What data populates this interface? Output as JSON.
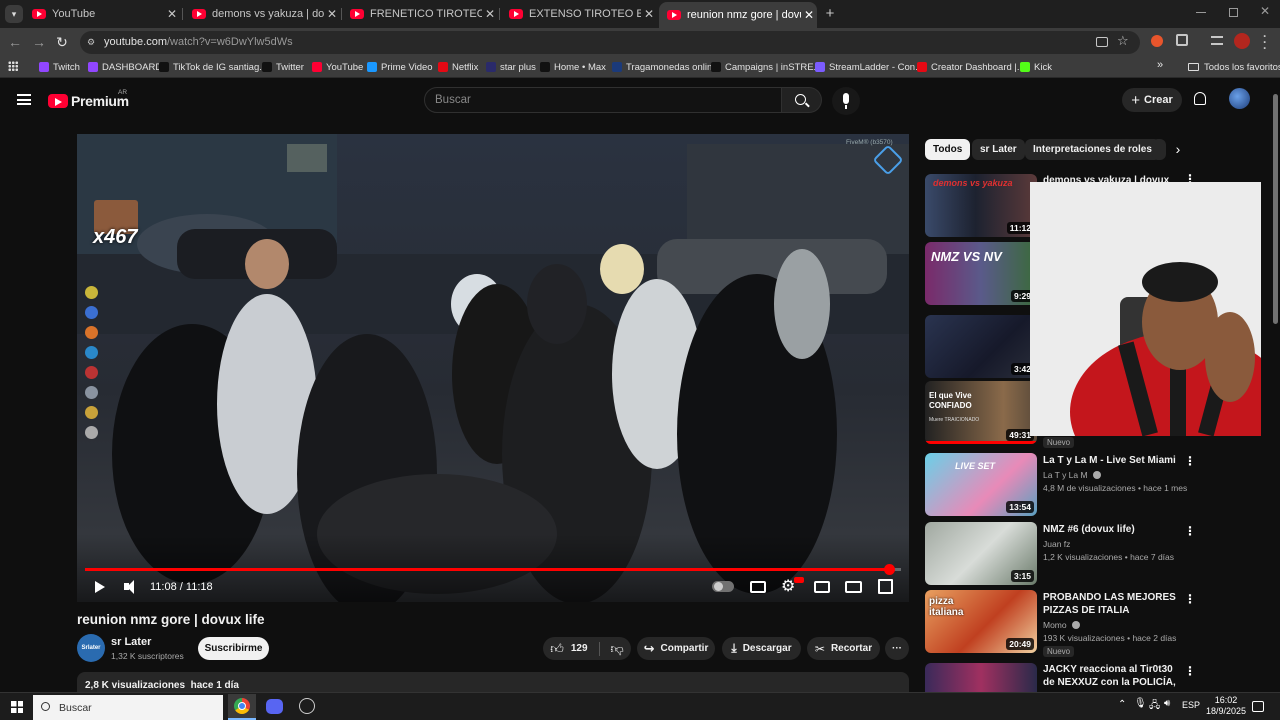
{
  "browser": {
    "tabs": [
      {
        "label": "YouTube"
      },
      {
        "label": "demons vs yakuza | dovux life -"
      },
      {
        "label": "FRENETICO TIROTEO ENTRE NA"
      },
      {
        "label": "EXTENSO TIROTEO ENTRE NAM"
      },
      {
        "label": "reunion nmz gore | dovux life"
      }
    ],
    "new_tab_label": "+",
    "url_host": "youtube.com",
    "url_path": "/watch?v=w6DwYlw5dWs",
    "bookmarks": [
      {
        "label": "Twitch",
        "color": "#9146ff"
      },
      {
        "label": "DASHBOARD",
        "color": "#9146ff"
      },
      {
        "label": "TikTok de IG santiag...",
        "color": "#111111"
      },
      {
        "label": "Twitter",
        "color": "#111111"
      },
      {
        "label": "YouTube",
        "color": "#ff0033"
      },
      {
        "label": "Prime Video",
        "color": "#1a98ff"
      },
      {
        "label": "Netflix",
        "color": "#e50914"
      },
      {
        "label": "star plus",
        "color": "#2a2a6a"
      },
      {
        "label": "Home • Max",
        "color": "#111111"
      },
      {
        "label": "Tragamonedas onlin...",
        "color": "#1b3a7a"
      },
      {
        "label": "Campaigns | inSTRE...",
        "color": "#111111"
      },
      {
        "label": "StreamLadder - Con...",
        "color": "#7b5cff"
      },
      {
        "label": "Creator Dashboard |...",
        "color": "#e50914"
      },
      {
        "label": "Kick",
        "color": "#53fc18"
      }
    ],
    "bookmarks_overflow": "»",
    "all_favorites_label": "Todos los favoritos"
  },
  "youtube": {
    "logo_text": "Premium",
    "logo_region": "AR",
    "search_placeholder": "Buscar",
    "create_label": "Crear"
  },
  "video": {
    "title": "reunion nmz gore | dovux life",
    "time_current": "11:08",
    "time_separator": "/",
    "time_total": "11:18",
    "progress_fraction": 0.985,
    "overlay_counter": "x467",
    "overlay_watermark": "FiveM® (b3570)"
  },
  "channel": {
    "avatar_text": "Srlater",
    "name": "sr Later",
    "subscribers": "1,32 K suscriptores",
    "subscribe_label": "Suscribirme"
  },
  "actions": {
    "likes": "129",
    "share_label": "Compartir",
    "download_label": "Descargar",
    "clip_label": "Recortar",
    "more_label": "···"
  },
  "description": {
    "views": "2,8 K visualizaciones",
    "age": "hace 1 día"
  },
  "chips": [
    {
      "label": "Todos"
    },
    {
      "label": "sr Later"
    },
    {
      "label": "Interpretaciones de roles"
    }
  ],
  "recommendations": [
    {
      "title": "demons vs yakuza | dovux life",
      "channel": "",
      "meta": "",
      "duration": "11:12",
      "thumb_text": "demons vs yakuza"
    },
    {
      "title": "",
      "channel": "",
      "meta": "",
      "duration": "9:29",
      "thumb_text": "NMZ VS NV"
    },
    {
      "title": "",
      "channel": "",
      "meta": "",
      "duration": "3:42",
      "thumb_text": ""
    },
    {
      "title": "",
      "channel": "",
      "meta": "",
      "duration": "49:31",
      "thumb_text": "El que Vive CONFIADO",
      "thumb_sub": "Muere TRAICIONADO",
      "badge": "Nuevo"
    },
    {
      "title": "La T y La M - Live Set Miami",
      "channel": "La T y La M",
      "meta": "4,8 M de visualizaciones • hace 1 mes",
      "duration": "13:54",
      "thumb_text": "LIVE SET"
    },
    {
      "title": "NMZ #6 (dovux life)",
      "channel": "Juan fz",
      "meta": "1,2 K visualizaciones • hace 7 días",
      "duration": "3:15",
      "thumb_text": ""
    },
    {
      "title": "PROBANDO LAS MEJORES PIZZAS DE ITALIA",
      "channel": "Momo",
      "meta": "193 K visualizaciones • hace 2 días",
      "duration": "20:49",
      "thumb_text": "pizza italiana",
      "badge": "Nuevo"
    },
    {
      "title": "JACKY reacciona al Tir0t30 de NEXXUZ con la POLICÍA, ...",
      "channel": "",
      "meta": "",
      "duration": "",
      "thumb_text": ""
    }
  ],
  "taskbar": {
    "search_placeholder": "Buscar",
    "lang": "ESP",
    "time": "16:02",
    "date": "18/9/2025"
  }
}
